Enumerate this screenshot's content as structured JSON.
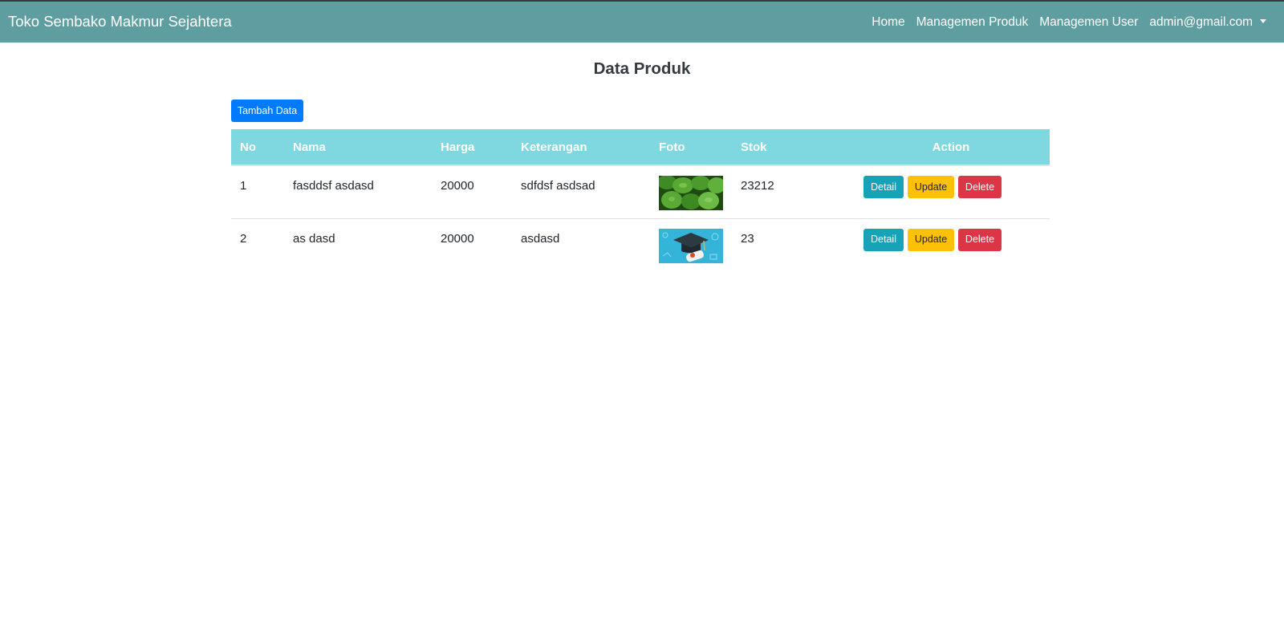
{
  "navbar": {
    "brand": "Toko Sembako Makmur Sejahtera",
    "links": [
      "Home",
      "Managemen Produk",
      "Managemen User"
    ],
    "user": "admin@gmail.com"
  },
  "page": {
    "title": "Data Produk",
    "add_button": "Tambah Data"
  },
  "table": {
    "headers": [
      "No",
      "Nama",
      "Harga",
      "Keterangan",
      "Foto",
      "Stok",
      "Action"
    ],
    "rows": [
      {
        "no": "1",
        "nama": "fasddsf asdasd",
        "harga": "20000",
        "keterangan": "sdfdsf asdsad",
        "foto": "green-leaves-photo",
        "stok": "23212"
      },
      {
        "no": "2",
        "nama": "as dasd",
        "harga": "20000",
        "keterangan": "asdasd",
        "foto": "graduation-cap-photo",
        "stok": "23"
      }
    ],
    "actions": {
      "detail": "Detail",
      "update": "Update",
      "delete": "Delete"
    }
  },
  "colors": {
    "navbar": "#5f9ea0",
    "table_header": "#7fd8e0",
    "primary": "#007bff",
    "info": "#17a2b8",
    "warning": "#ffc107",
    "danger": "#dc3545"
  }
}
